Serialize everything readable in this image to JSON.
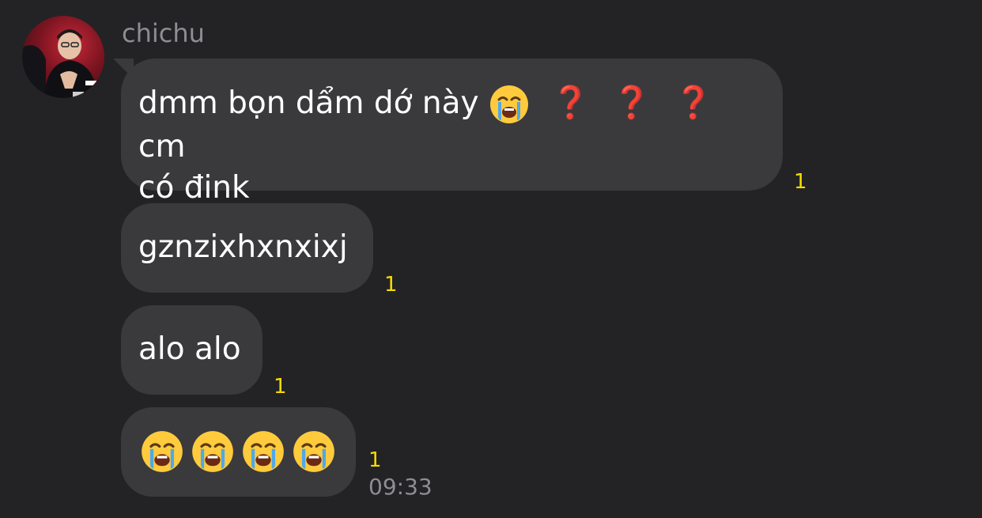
{
  "sender": {
    "name": "chichu"
  },
  "messages": [
    {
      "text_before": "dmm bọn dẩm dớ này",
      "emoji": "loudly-crying-face",
      "marks": [
        "❓",
        "❓",
        "❓"
      ],
      "text_after": "cm",
      "line2": "có đink",
      "read_count": "1"
    },
    {
      "text": "gznzixhxnxixj",
      "read_count": "1"
    },
    {
      "text": "alo alo",
      "read_count": "1"
    },
    {
      "emojis": [
        "loudly-crying-face",
        "loudly-crying-face",
        "loudly-crying-face",
        "loudly-crying-face"
      ],
      "read_count": "1",
      "time": "09:33"
    }
  ],
  "colors": {
    "background": "#232325",
    "bubble": "#3a3a3c",
    "read_indicator": "#f5dc00",
    "meta_text": "#8d8d92"
  }
}
